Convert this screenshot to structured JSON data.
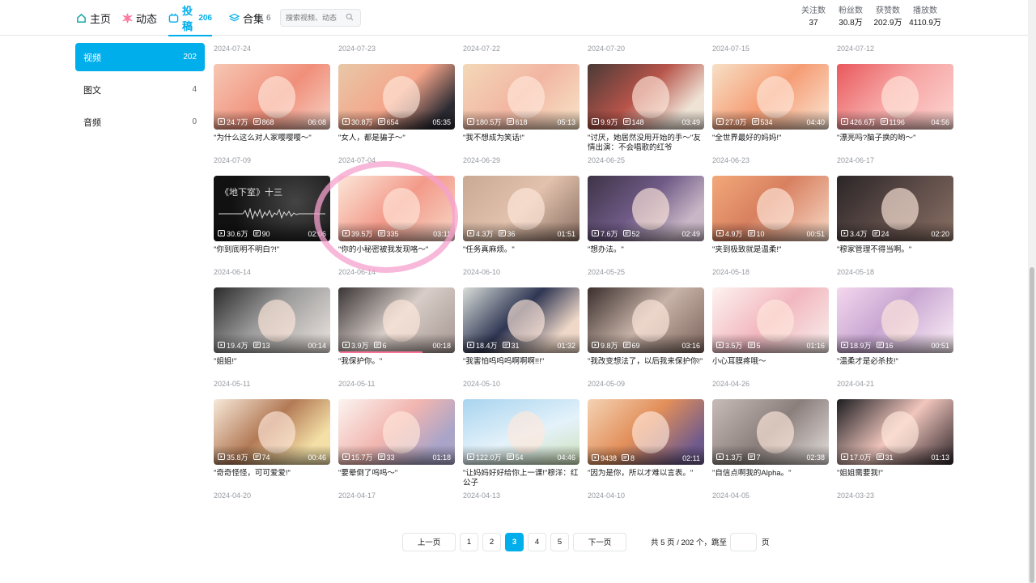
{
  "nav": {
    "home_label": "主页",
    "dynamic_label": "动态",
    "posts_label": "投稿",
    "posts_count": "206",
    "collection_label": "合集",
    "collection_count": "6",
    "search_placeholder": "搜索视频、动态"
  },
  "stats": [
    {
      "label": "关注数",
      "value": "37"
    },
    {
      "label": "粉丝数",
      "value": "30.8万"
    },
    {
      "label": "获赞数",
      "value": "202.9万"
    },
    {
      "label": "播放数",
      "value": "4110.9万"
    }
  ],
  "sidebar": {
    "items": [
      {
        "label": "视频",
        "count": "202"
      },
      {
        "label": "图文",
        "count": "4"
      },
      {
        "label": "音频",
        "count": "0"
      }
    ]
  },
  "videos": [
    {
      "date": "2024-07-24",
      "views": "24.7万",
      "danmaku": "868",
      "duration": "06:08",
      "title": "\"为什么这么对人家嘤嘤嘤～\""
    },
    {
      "date": "2024-07-23",
      "views": "30.8万",
      "danmaku": "654",
      "duration": "05:35",
      "title": "\"女人，都是骗子～\""
    },
    {
      "date": "2024-07-22",
      "views": "180.5万",
      "danmaku": "618",
      "duration": "05:13",
      "title": "\"我不想成为笑话!\""
    },
    {
      "date": "2024-07-20",
      "views": "9.9万",
      "danmaku": "148",
      "duration": "03:49",
      "title": "\"讨厌，她居然没用开始的手～\"友情出演：不会唱歌的红爷"
    },
    {
      "date": "2024-07-15",
      "views": "27.0万",
      "danmaku": "534",
      "duration": "04:40",
      "title": "\"全世界最好的妈妈!\""
    },
    {
      "date": "2024-07-12",
      "views": "426.6万",
      "danmaku": "1196",
      "duration": "04:56",
      "title": "\"漂亮吗?脑子换的哟～\""
    },
    {
      "date": "2024-07-09",
      "views": "30.6万",
      "danmaku": "90",
      "duration": "02:06",
      "title": "\"你到底明不明白?!\""
    },
    {
      "date": "2024-07-04",
      "views": "39.5万",
      "danmaku": "335",
      "duration": "03:11",
      "title": "\"你的小秘密被我发现咯～\""
    },
    {
      "date": "2024-06-29",
      "views": "4.3万",
      "danmaku": "36",
      "duration": "01:51",
      "title": "\"任务真麻烦。\""
    },
    {
      "date": "2024-06-25",
      "views": "7.6万",
      "danmaku": "52",
      "duration": "02:49",
      "title": "\"想办法。\""
    },
    {
      "date": "2024-06-23",
      "views": "4.9万",
      "danmaku": "10",
      "duration": "00:51",
      "title": "\"夹到极致就是温柔!\""
    },
    {
      "date": "2024-06-17",
      "views": "3.4万",
      "danmaku": "24",
      "duration": "02:20",
      "title": "\"穆家管理不得当啊。\""
    },
    {
      "date": "2024-06-14",
      "views": "19.4万",
      "danmaku": "13",
      "duration": "00:14",
      "title": "\"姐姐!\""
    },
    {
      "date": "2024-06-14",
      "views": "3.9万",
      "danmaku": "6",
      "duration": "00:18",
      "title": "\"我保护你。\""
    },
    {
      "date": "2024-06-10",
      "views": "18.4万",
      "danmaku": "31",
      "duration": "01:32",
      "title": "\"我害怕呜呜呜啊啊啊!!!\""
    },
    {
      "date": "2024-05-25",
      "views": "9.8万",
      "danmaku": "69",
      "duration": "03:16",
      "title": "\"我改变想法了，以后我来保护你!\""
    },
    {
      "date": "2024-05-18",
      "views": "3.5万",
      "danmaku": "5",
      "duration": "01:16",
      "title": "小心耳膜疼哦～"
    },
    {
      "date": "2024-05-18",
      "views": "18.9万",
      "danmaku": "16",
      "duration": "00:51",
      "title": "\"温柔才是必杀技!\""
    },
    {
      "date": "2024-05-11",
      "views": "35.8万",
      "danmaku": "74",
      "duration": "00:46",
      "title": "\"奇奇怪怪，可可爱爱!\""
    },
    {
      "date": "2024-05-11",
      "views": "15.7万",
      "danmaku": "33",
      "duration": "01:18",
      "title": "\"要晕倒了呜呜～\""
    },
    {
      "date": "2024-05-10",
      "views": "122.0万",
      "danmaku": "54",
      "duration": "04:46",
      "title": "\"让妈妈好好给你上一课!\"穆洋：红公子"
    },
    {
      "date": "2024-05-09",
      "views": "9438",
      "danmaku": "8",
      "duration": "02:11",
      "title": "\"因为是你，所以才难以言表。\""
    },
    {
      "date": "2024-04-26",
      "views": "1.3万",
      "danmaku": "7",
      "duration": "02:38",
      "title": "\"自信点啊我的Alpha。\""
    },
    {
      "date": "2024-04-21",
      "views": "17.0万",
      "danmaku": "31",
      "duration": "01:13",
      "title": "\"姐姐需要我!\""
    }
  ],
  "next_row_dates": [
    "2024-04-20",
    "2024-04-17",
    "2024-04-13",
    "2024-04-10",
    "2024-04-05",
    "2024-03-23"
  ],
  "thumb_overlay_text": {
    "v2": "《地下室》十三"
  },
  "progress": {
    "v14_watched_fraction": 0.72
  },
  "pager": {
    "prev_label": "上一页",
    "pages": [
      "1",
      "2",
      "3",
      "4",
      "5"
    ],
    "current": "3",
    "next_label": "下一页",
    "info_label": "共 5 页 / 202 个，跳至",
    "page_suffix": "页"
  },
  "colors": {
    "accent": "#00aeec",
    "annotation": "#f6a0cd"
  }
}
